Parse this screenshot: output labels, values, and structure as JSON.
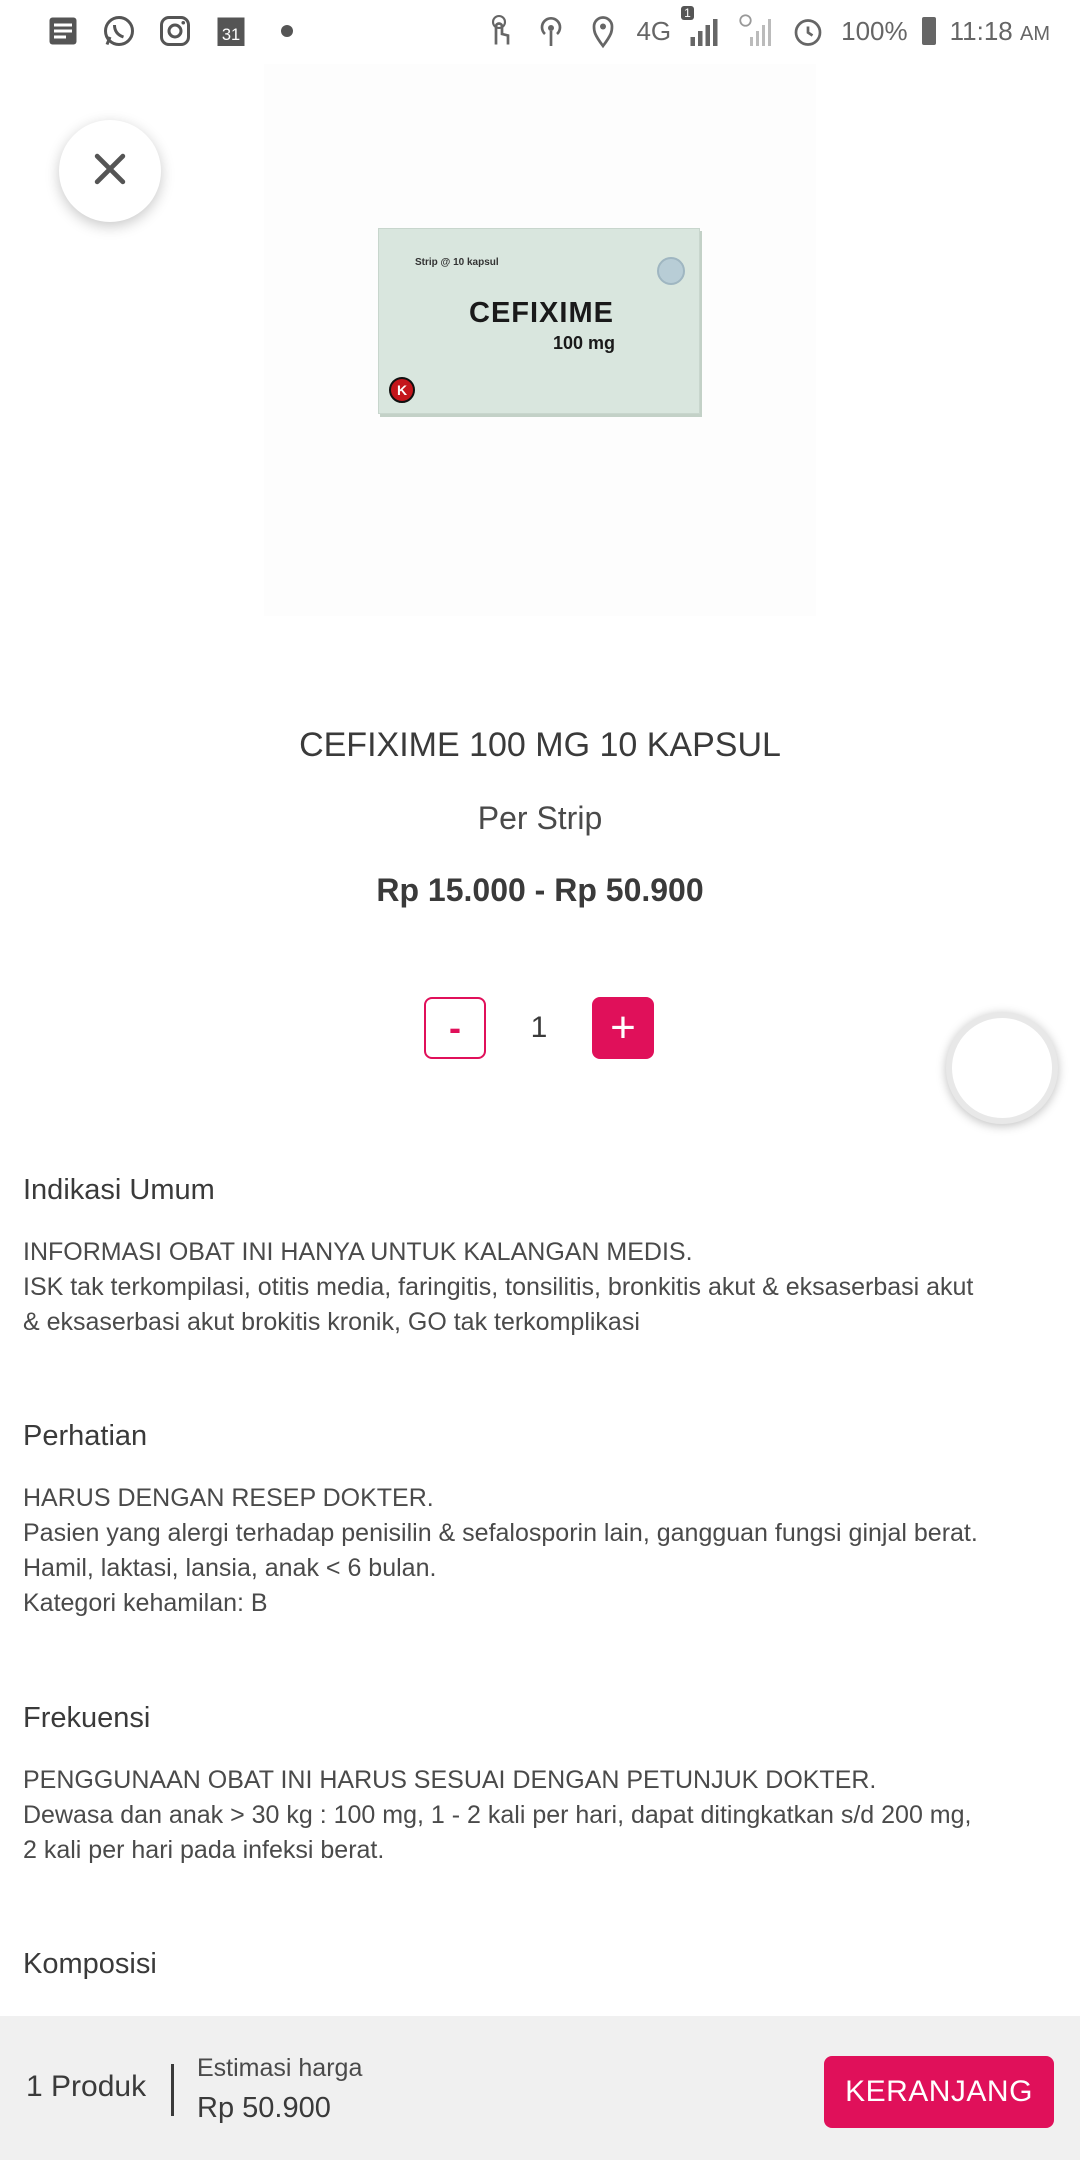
{
  "status_bar": {
    "left_icons": [
      "message-icon",
      "whatsapp-icon",
      "instagram-icon",
      "calendar-icon",
      "dot-icon"
    ],
    "calendar_day": "31",
    "network": "4G",
    "sim_badge": "1",
    "battery": "100%",
    "time": "11:18",
    "ampm": "AM"
  },
  "product": {
    "image": {
      "box_label_top": "Strip @ 10 kapsul",
      "box_name": "CEFIXIME",
      "box_dose": "100 mg",
      "box_mark": "K"
    },
    "title": "CEFIXIME 100 MG 10 KAPSUL",
    "unit": "Per Strip",
    "price_range": "Rp 15.000 - Rp 50.900"
  },
  "stepper": {
    "minus_label": "-",
    "quantity": "1",
    "plus_label": "+"
  },
  "sections": [
    {
      "title": "Indikasi Umum",
      "lines": [
        "INFORMASI OBAT INI HANYA UNTUK KALANGAN MEDIS.",
        "ISK tak terkompilasi, otitis media, faringitis, tonsilitis, bronkitis akut & eksaserbasi akut",
        "& eksaserbasi akut brokitis kronik, GO tak terkomplikasi"
      ]
    },
    {
      "title": "Perhatian",
      "lines": [
        "HARUS DENGAN RESEP DOKTER.",
        "Pasien yang alergi terhadap penisilin & sefalosporin lain, gangguan fungsi ginjal berat.",
        "Hamil, laktasi, lansia, anak < 6 bulan.",
        "Kategori kehamilan: B"
      ]
    },
    {
      "title": "Frekuensi",
      "lines": [
        "PENGGUNAAN OBAT INI HARUS SESUAI DENGAN PETUNJUK DOKTER.",
        "Dewasa dan anak > 30 kg : 100 mg, 1 - 2 kali per hari, dapat ditingkatkan s/d 200 mg,",
        "2 kali per hari pada infeksi berat."
      ]
    },
    {
      "title": "Komposisi",
      "lines": []
    }
  ],
  "bottom_bar": {
    "product_count": "1 Produk",
    "estimate_label": "Estimasi harga",
    "estimate_value": "Rp 50.900",
    "cart_button": "KERANJANG"
  },
  "colors": {
    "accent": "#e0105a",
    "text": "#3a3a3a",
    "bottom_bar_bg": "#f0f0f0"
  }
}
